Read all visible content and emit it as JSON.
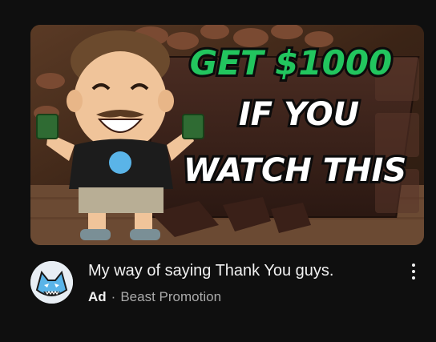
{
  "video": {
    "thumbnail_text": {
      "line1": "GET $1000",
      "line2": "IF YOU",
      "line3": "WATCH THIS"
    },
    "title": "My way of saying Thank You guys.",
    "ad_label": "Ad",
    "separator": "·",
    "channel": "Beast Promotion",
    "menu_icon": "more-vert-icon"
  },
  "colors": {
    "background": "#0f0f0f",
    "title": "#f1f1f1",
    "secondary_text": "#aaaaaa",
    "thumb_highlight": "#22c55e"
  }
}
